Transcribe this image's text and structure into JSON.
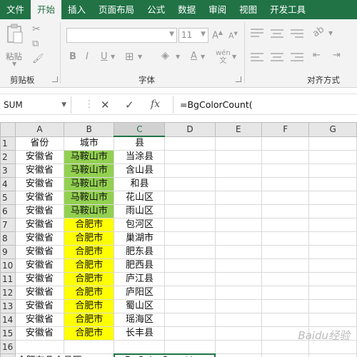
{
  "ribbon_tabs": [
    "文件",
    "开始",
    "插入",
    "页面布局",
    "公式",
    "数据",
    "审阅",
    "视图",
    "开发工具"
  ],
  "active_tab": "开始",
  "ribbon": {
    "paste_label": "粘贴",
    "clipboard_label": "剪贴板",
    "font_group_label": "字体",
    "align_group_label": "对齐方式",
    "font_size": "11",
    "bold_label": "B",
    "italic_label": "I",
    "underline_label": "U",
    "wen_label": "wén"
  },
  "formula_bar": {
    "name_box": "SUM",
    "fx_label": "fx",
    "formula": "=BgColorCount("
  },
  "columns": [
    "A",
    "B",
    "C",
    "D",
    "E",
    "F",
    "G"
  ],
  "header_row": [
    "省份",
    "城市",
    "县"
  ],
  "rows": [
    [
      "安徽省",
      "马鞍山市",
      "当涂县"
    ],
    [
      "安徽省",
      "马鞍山市",
      "含山县"
    ],
    [
      "安徽省",
      "马鞍山市",
      "和县"
    ],
    [
      "安徽省",
      "马鞍山市",
      "花山区"
    ],
    [
      "安徽省",
      "马鞍山市",
      "雨山区"
    ],
    [
      "安徽省",
      "合肥市",
      "包河区"
    ],
    [
      "安徽省",
      "合肥市",
      "巢湖市"
    ],
    [
      "安徽省",
      "合肥市",
      "肥东县"
    ],
    [
      "安徽省",
      "合肥市",
      "肥西县"
    ],
    [
      "安徽省",
      "合肥市",
      "庐江县"
    ],
    [
      "安徽省",
      "合肥市",
      "庐阳区"
    ],
    [
      "安徽省",
      "合肥市",
      "蜀山区"
    ],
    [
      "安徽省",
      "合肥市",
      "瑶海区"
    ],
    [
      "安徽省",
      "合肥市",
      "长丰县"
    ]
  ],
  "row_17": {
    "question": "合肥有几个县区",
    "editing_value": "=BgColorCount("
  },
  "watermark": "Baidu经验",
  "colors": {
    "excel_green": "#217346",
    "fill_green": "#92d050",
    "fill_yellow": "#ffff00"
  }
}
